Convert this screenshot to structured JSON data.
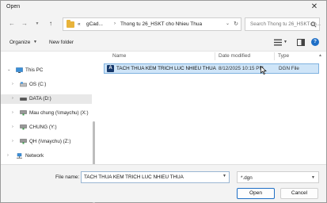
{
  "window": {
    "title": "Open"
  },
  "address": {
    "prefix": "«",
    "part1": "gCad...",
    "separator": "›",
    "part2": "Thong tu 26_HSKT cho Nhieu Thua"
  },
  "search": {
    "placeholder": "Search Thong tu 26_HSKT ch..."
  },
  "toolbar": {
    "organize_label": "Organize",
    "new_folder_label": "New folder"
  },
  "sidebar": {
    "items": [
      {
        "label": "This PC",
        "icon": "pc-icon"
      },
      {
        "label": "OS (C:)",
        "icon": "drive-icon"
      },
      {
        "label": "DATA (D:)",
        "icon": "drive-icon"
      },
      {
        "label": "Mau chung (\\\\maychu) (X:)",
        "icon": "network-drive-icon"
      },
      {
        "label": "CHUNG (Y:)",
        "icon": "network-drive-icon"
      },
      {
        "label": "QH (\\\\maychu) (Z:)",
        "icon": "network-drive-icon"
      },
      {
        "label": "Network",
        "icon": "network-icon"
      }
    ]
  },
  "columns": {
    "name": "Name",
    "date": "Date modified",
    "type": "Type"
  },
  "files": [
    {
      "name": "TACH THUA KEM TRICH LUC NHIEU THUA",
      "date": "8/12/2025 10:15 PM",
      "type": "DGN File"
    }
  ],
  "bottom": {
    "file_name_label": "File name:",
    "file_name_value": "TACH THUA KEM TRICH LUC NHIEU THUA",
    "filter": "*.dgn",
    "open_label": "Open",
    "cancel_label": "Cancel"
  },
  "colors": {
    "accent": "#1f6fc5",
    "selection": "#cfe5f8",
    "folder": "#e8b33a"
  }
}
